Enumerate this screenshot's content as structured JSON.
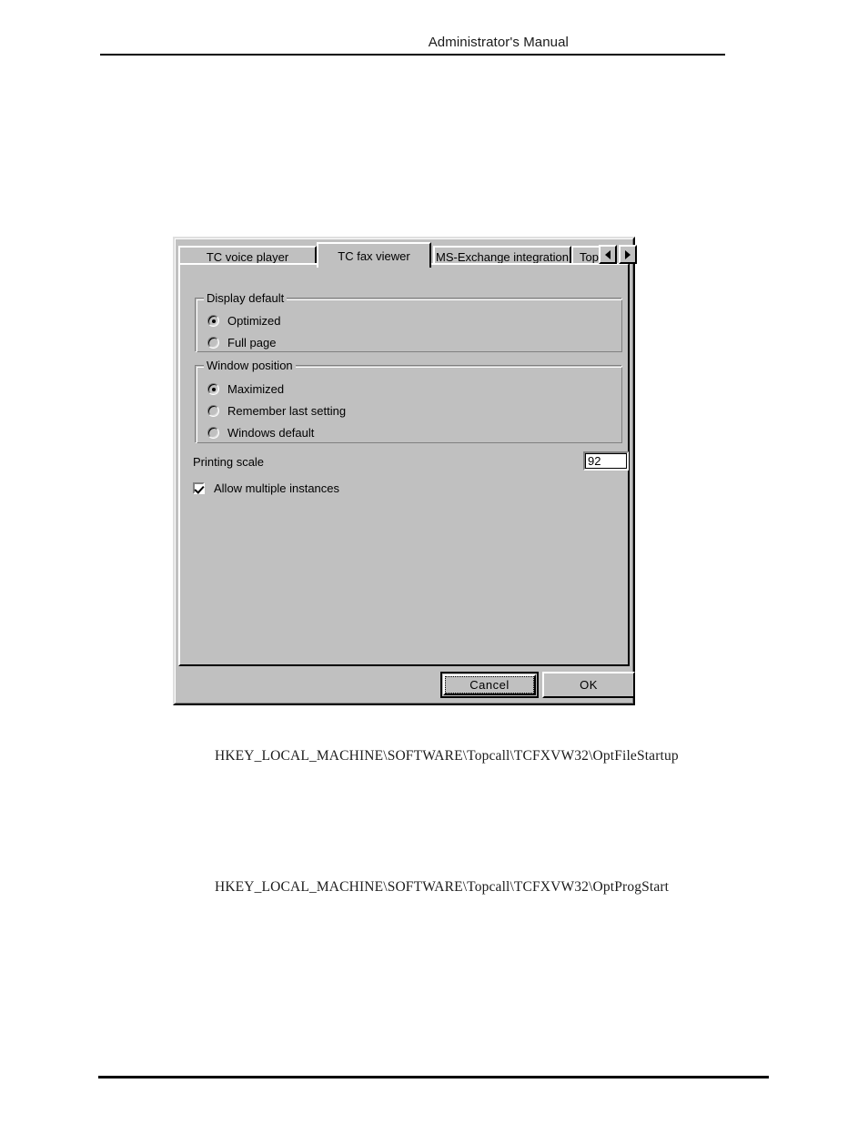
{
  "page": {
    "header_text": "Administrator's Manual",
    "registry_paths": [
      "HKEY_LOCAL_MACHINE\\SOFTWARE\\Topcall\\TCFXVW32\\OptFileStartup",
      "HKEY_LOCAL_MACHINE\\SOFTWARE\\Topcall\\TCFXVW32\\OptProgStart"
    ]
  },
  "dialog": {
    "tabs": [
      {
        "label": "TC voice player",
        "active": false
      },
      {
        "label": "TC  fax viewer",
        "active": true
      },
      {
        "label": "MS-Exchange integration",
        "active": false
      },
      {
        "label": "TopC",
        "active": false
      }
    ],
    "tab_scroll": {
      "left_icon": "triangle-left-icon",
      "right_icon": "triangle-right-icon"
    },
    "groups": [
      {
        "title": "Display default",
        "options": [
          {
            "label": "Optimized",
            "selected": true
          },
          {
            "label": "Full page",
            "selected": false
          }
        ]
      },
      {
        "title": "Window position",
        "options": [
          {
            "label": "Maximized",
            "selected": true
          },
          {
            "label": "Remember last setting",
            "selected": false
          },
          {
            "label": "Windows default",
            "selected": false
          }
        ]
      }
    ],
    "printing_scale": {
      "label": "Printing scale",
      "value": "92"
    },
    "allow_multiple_instances": {
      "label": "Allow multiple instances",
      "checked": true
    },
    "buttons": {
      "cancel": "Cancel",
      "ok": "OK"
    }
  },
  "colors": {
    "dialog_face": "#c0c0c0",
    "highlight": "#ffffff",
    "shadow": "#808080",
    "dark_shadow": "#000000",
    "field_bg": "#ffffff",
    "text": "#000000"
  }
}
